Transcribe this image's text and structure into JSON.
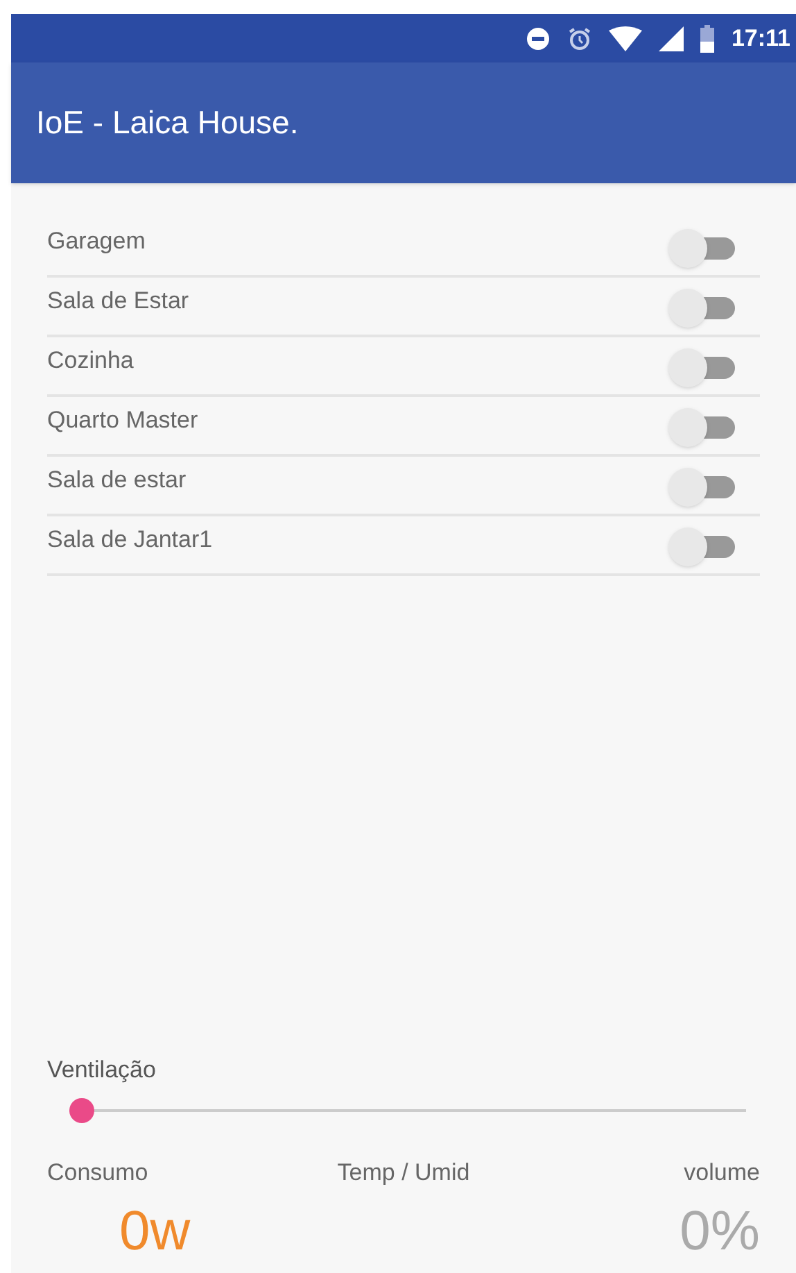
{
  "status_bar": {
    "time": "17:11"
  },
  "app_bar": {
    "title": "IoE - Laica House."
  },
  "rooms": [
    {
      "label": "Garagem",
      "on": false
    },
    {
      "label": "Sala de Estar",
      "on": false
    },
    {
      "label": "Cozinha",
      "on": false
    },
    {
      "label": "Quarto Master",
      "on": false
    },
    {
      "label": "Sala de estar",
      "on": false
    },
    {
      "label": "Sala de Jantar1",
      "on": false
    }
  ],
  "ventilation": {
    "label": "Ventilação",
    "level": 0
  },
  "readings": [
    {
      "label": "Consumo",
      "value": "0w",
      "kind": "power"
    },
    {
      "label": "Temp / Umid",
      "kind": "climate"
    },
    {
      "label": "volume",
      "value": "0%",
      "kind": "volume"
    }
  ]
}
